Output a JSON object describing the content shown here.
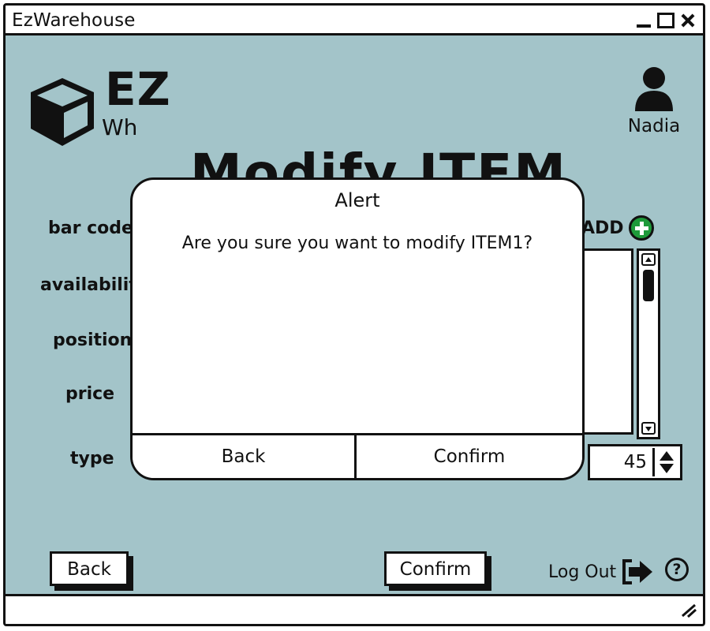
{
  "window": {
    "title": "EzWarehouse"
  },
  "logo": {
    "line1": "EZ",
    "line2": "Wh"
  },
  "user": {
    "name": "Nadia"
  },
  "page": {
    "title": "Modify ITEM"
  },
  "form": {
    "labels": {
      "bar_code": "bar code",
      "availability": "availabilit",
      "position": "position",
      "price": "price",
      "type": "type"
    },
    "add_label": "ADD",
    "quantity_value": "45"
  },
  "footer": {
    "back_label": "Back",
    "confirm_label": "Confirm",
    "logout_label": "Log Out",
    "help_symbol": "?"
  },
  "modal": {
    "title": "Alert",
    "message": "Are you sure you want to modify ITEM1?",
    "back_label": "Back",
    "confirm_label": "Confirm"
  },
  "colors": {
    "background": "#a3c4c9",
    "add_button": "#1e9a3a"
  }
}
